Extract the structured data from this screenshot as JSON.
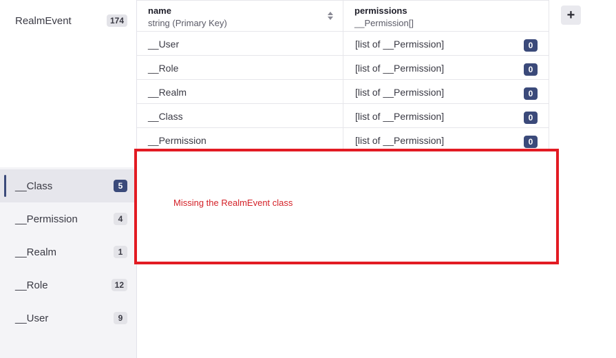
{
  "sidebar": {
    "top_item": {
      "label": "RealmEvent",
      "count": "174"
    },
    "items": [
      {
        "label": "__Class",
        "count": "5"
      },
      {
        "label": "__Permission",
        "count": "4"
      },
      {
        "label": "__Realm",
        "count": "1"
      },
      {
        "label": "__Role",
        "count": "12"
      },
      {
        "label": "__User",
        "count": "9"
      }
    ]
  },
  "table": {
    "columns": [
      {
        "name": "name",
        "type": "string (Primary Key)"
      },
      {
        "name": "permissions",
        "type": "__Permission[]"
      }
    ],
    "rows": [
      {
        "name": "__User",
        "permissions": "[list of __Permission]",
        "count": "0"
      },
      {
        "name": "__Role",
        "permissions": "[list of __Permission]",
        "count": "0"
      },
      {
        "name": "__Realm",
        "permissions": "[list of __Permission]",
        "count": "0"
      },
      {
        "name": "__Class",
        "permissions": "[list of __Permission]",
        "count": "0"
      },
      {
        "name": "__Permission",
        "permissions": "[list of __Permission]",
        "count": "0"
      }
    ]
  },
  "add_column_label": "+",
  "annotation": {
    "text": "Missing the RealmEvent class",
    "color": "#e21b23"
  }
}
